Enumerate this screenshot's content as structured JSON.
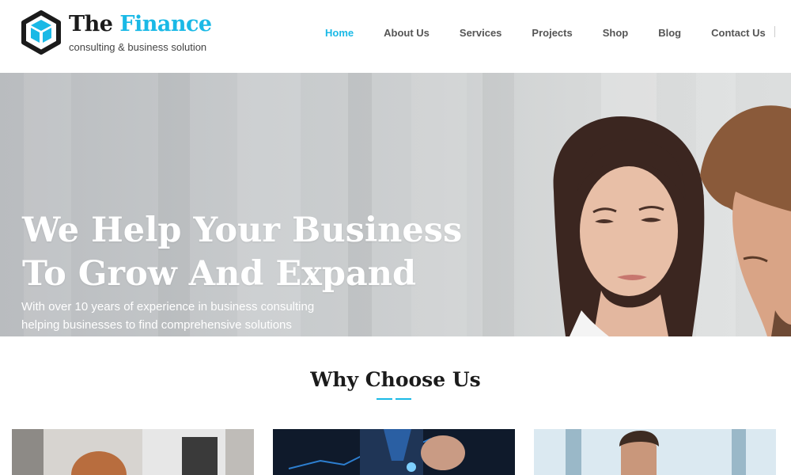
{
  "brand": {
    "name_part1": "The",
    "name_part2": "Finance",
    "tagline": "consulting & business solution",
    "logo_icon": "hexagon-cube-logo",
    "accent_color": "#1ab9e6"
  },
  "nav": {
    "items": [
      {
        "label": "Home",
        "active": true
      },
      {
        "label": "About Us",
        "active": false
      },
      {
        "label": "Services",
        "active": false
      },
      {
        "label": "Projects",
        "active": false
      },
      {
        "label": "Shop",
        "active": false
      },
      {
        "label": "Blog",
        "active": false
      },
      {
        "label": "Contact Us",
        "active": false
      }
    ]
  },
  "hero": {
    "title_line1": "We Help Your Business",
    "title_line2": "To Grow And Expand",
    "subtitle_line1": "With over 10 years of experience in business consulting",
    "subtitle_line2": "helping businesses to find comprehensive solutions"
  },
  "why_choose": {
    "title": "Why Choose Us",
    "cards": [
      {
        "image": "office-woman-photo"
      },
      {
        "image": "business-chart-photo"
      },
      {
        "image": "businessman-portrait-photo"
      }
    ]
  }
}
